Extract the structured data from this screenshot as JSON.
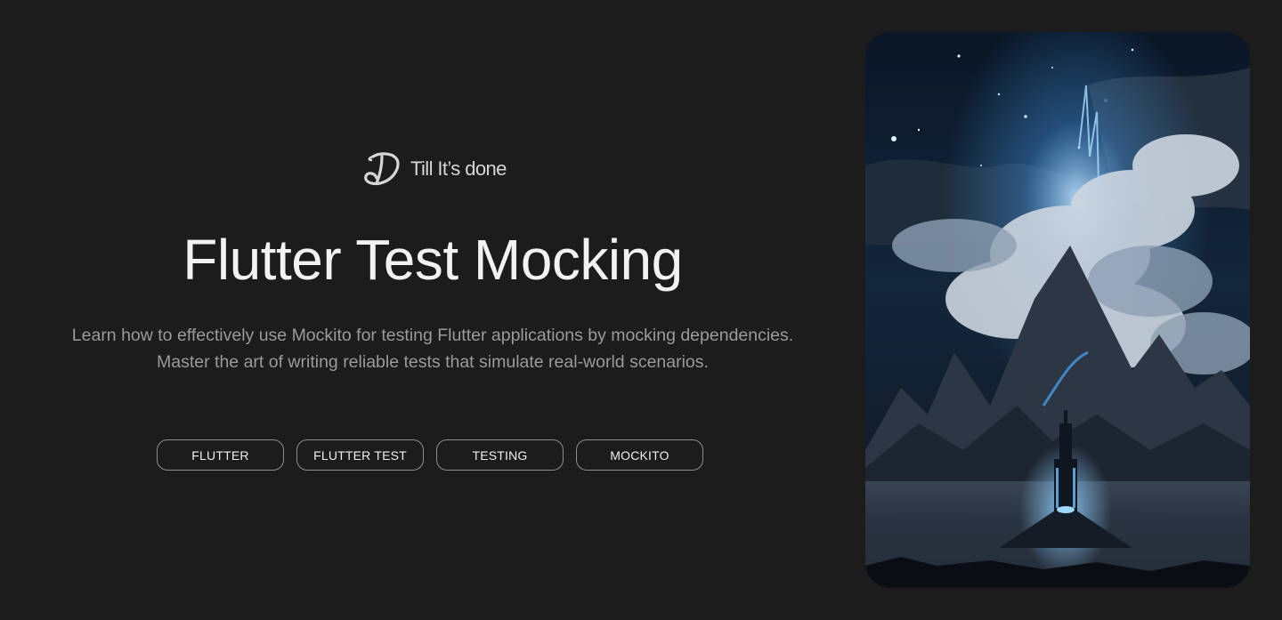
{
  "brand": {
    "name": "Till It’s done",
    "logo_icon": "script-d-logo-icon"
  },
  "hero": {
    "title": "Flutter Test Mocking",
    "description": "Learn how to effectively use Mockito for testing Flutter applications by mocking dependencies. Master the art of writing reliable tests that simulate real-world scenarios."
  },
  "tags": [
    {
      "label": "FLUTTER"
    },
    {
      "label": "FLUTTER TEST"
    },
    {
      "label": "TESTING"
    },
    {
      "label": "MOCKITO"
    }
  ],
  "image": {
    "subject": "fantasy-night-landscape-with-glowing-tower",
    "colors": {
      "sky": "#0b1a2b",
      "accent": "#4aa8ff",
      "cloud": "#cfd6de",
      "ground": "#1a2230"
    }
  },
  "colors": {
    "background": "#1c1c1c",
    "title": "#f2f2f2",
    "text": "#9a9a9a",
    "tag_border": "#8e8e8e"
  }
}
